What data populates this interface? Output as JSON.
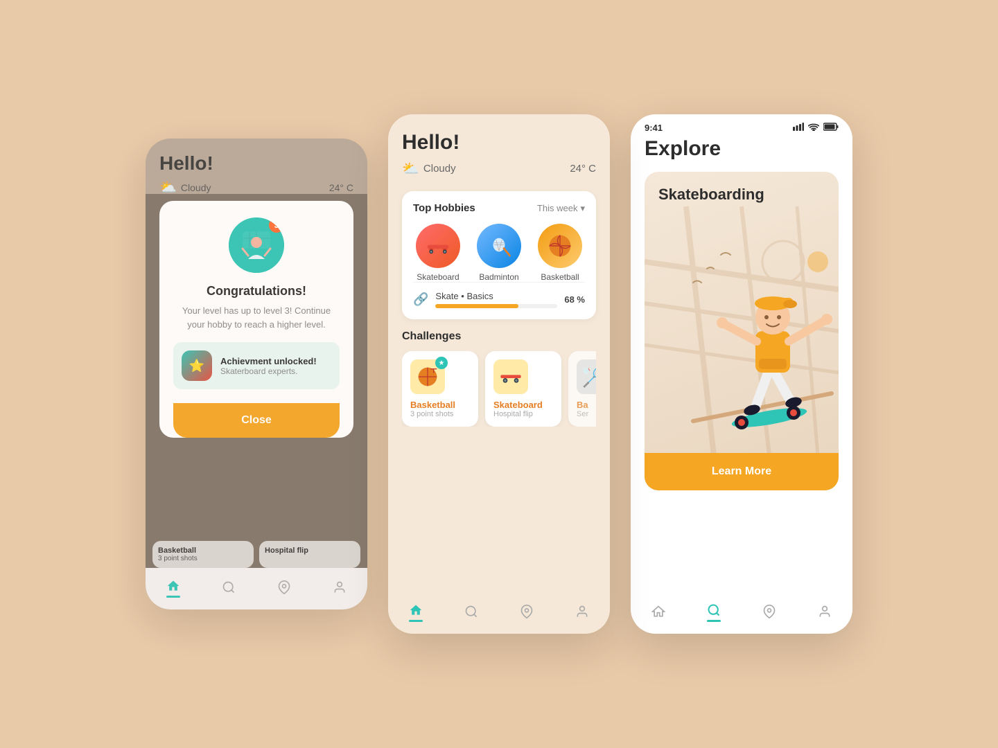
{
  "phone1": {
    "greeting": "Hello!",
    "weather": {
      "condition": "Cloudy",
      "temperature": "24° C"
    },
    "modal": {
      "badge_number": "3",
      "title": "Congratulations!",
      "description": "Your level has up to level 3! Continue your hobby to reach a higher level.",
      "achievement_title": "Achievment unlocked!",
      "achievement_sub": "Skaterboard experts.",
      "close_button": "Close"
    },
    "peek_cards": [
      {
        "title": "Basketball",
        "sub": "3 point shots"
      },
      {
        "title": "Hospital flip",
        "sub": ""
      }
    ]
  },
  "phone2": {
    "greeting": "Hello!",
    "weather": {
      "condition": "Cloudy",
      "temperature": "24° C"
    },
    "top_hobbies": {
      "label": "Top Hobbies",
      "filter": "This week",
      "items": [
        {
          "name": "Skateboard",
          "emoji": "🛹"
        },
        {
          "name": "Badminton",
          "emoji": "🏸"
        },
        {
          "name": "Basketball",
          "emoji": "🏀"
        }
      ]
    },
    "progress": {
      "label": "Skate",
      "sublabel": "Basics",
      "percent": 68,
      "percent_label": "68 %"
    },
    "challenges": {
      "label": "Challenges",
      "items": [
        {
          "name": "Basketball",
          "sub": "3 point shots",
          "emoji": "🏀"
        },
        {
          "name": "Skateboard",
          "sub": "Hospital flip",
          "emoji": "🛹"
        },
        {
          "name": "Ba",
          "sub": "Ser",
          "emoji": "🏸"
        }
      ]
    }
  },
  "phone3": {
    "status_bar": {
      "time": "9:41",
      "signal": "▪▪▪▪",
      "wifi": "wifi",
      "battery": "battery"
    },
    "page_title": "Explore",
    "explore_card": {
      "sport_title": "Skateboarding"
    },
    "learn_more_button": "Learn More",
    "nav_items": [
      "home",
      "search",
      "location",
      "profile"
    ]
  },
  "shared": {
    "nav_items": [
      {
        "icon": "🏠",
        "active": true
      },
      {
        "icon": "🔍",
        "active": false
      },
      {
        "icon": "📍",
        "active": false
      },
      {
        "icon": "👤",
        "active": false
      }
    ],
    "accent_color": "#f5a623",
    "teal_color": "#2ec4b6"
  }
}
